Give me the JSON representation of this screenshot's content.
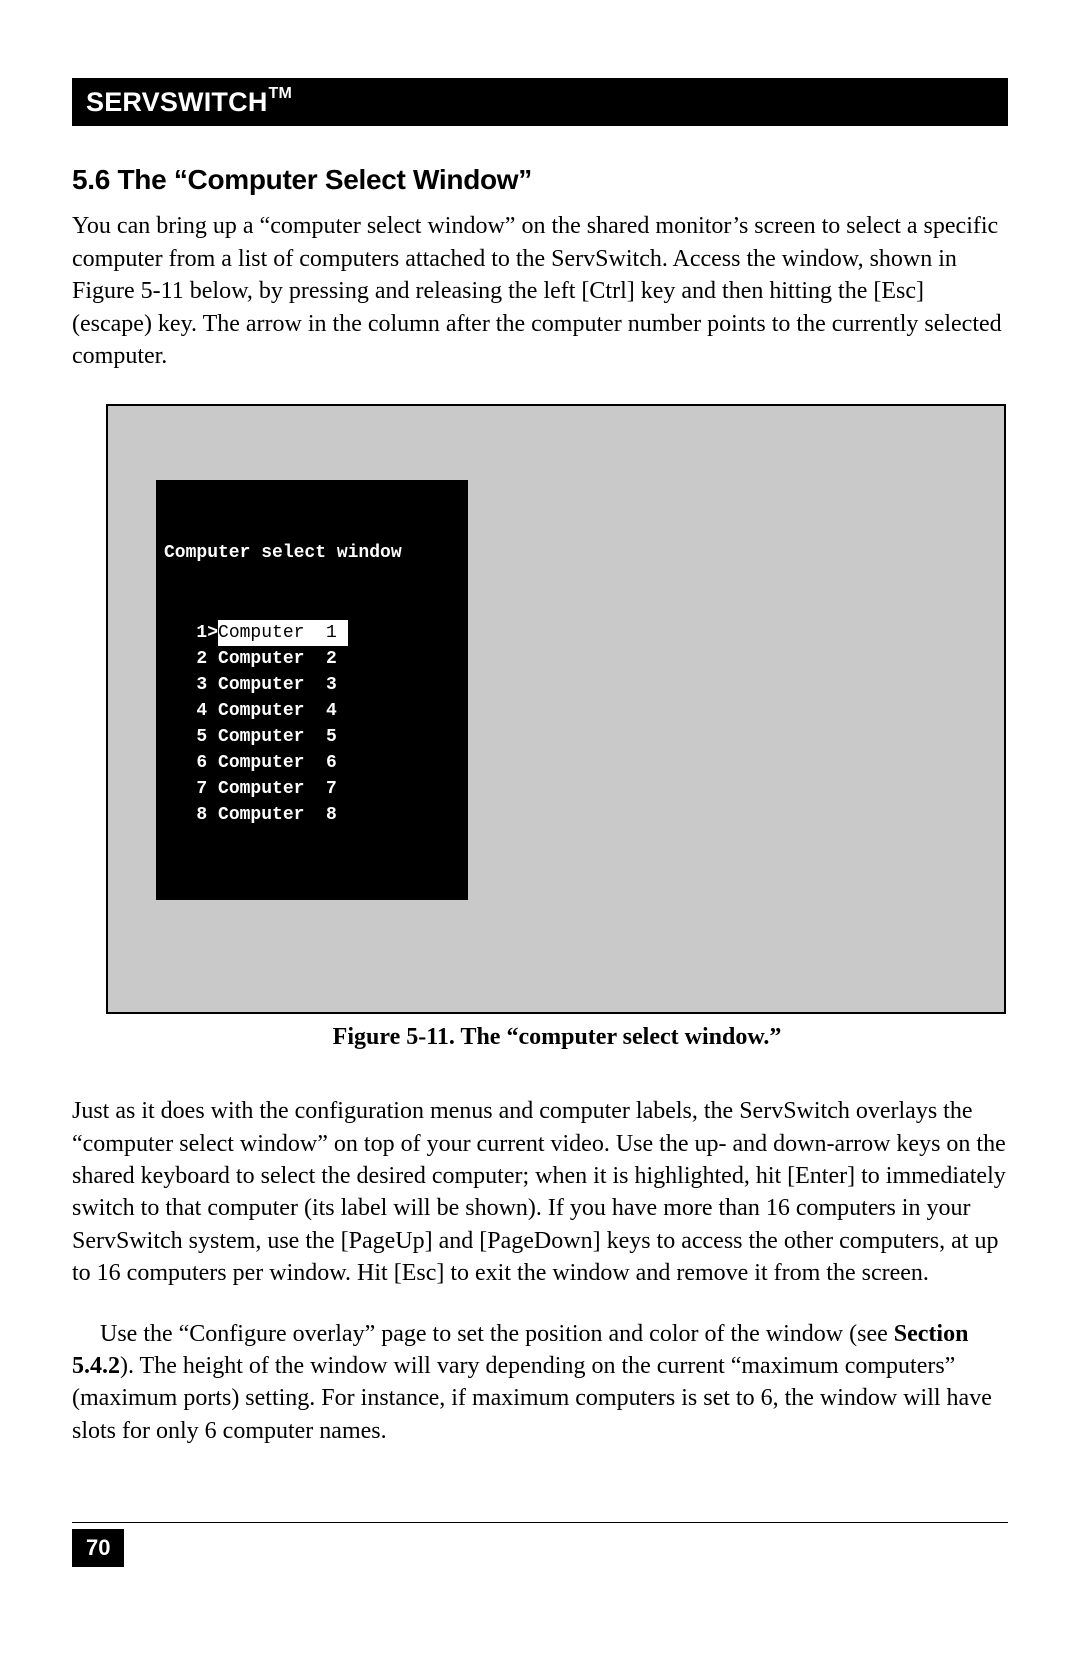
{
  "header": {
    "brand": "SERVSWITCH",
    "tm": "TM"
  },
  "section": {
    "heading": "5.6 The “Computer Select Window”"
  },
  "para1": "You can bring up a “computer select window” on the shared monitor’s screen to select a specific computer from a list of computers attached to the ServSwitch. Access the window, shown in Figure 5-11 below, by pressing and releasing the left [Ctrl] key and then hitting the [Esc] (escape) key. The arrow in the column after the computer number points to the currently selected computer.",
  "figure": {
    "panel_title": "Computer select window",
    "selected_index": 1,
    "rows": [
      {
        "num": "1",
        "label": "Computer  1"
      },
      {
        "num": "2",
        "label": "Computer  2"
      },
      {
        "num": "3",
        "label": "Computer  3"
      },
      {
        "num": "4",
        "label": "Computer  4"
      },
      {
        "num": "5",
        "label": "Computer  5"
      },
      {
        "num": "6",
        "label": "Computer  6"
      },
      {
        "num": "7",
        "label": "Computer  7"
      },
      {
        "num": "8",
        "label": "Computer  8"
      }
    ],
    "caption": "Figure 5-11. The “computer select window.”"
  },
  "para2": "Just as it does with the configuration menus and computer labels, the ServSwitch overlays the “computer select window” on top of your current video. Use the up- and down-arrow keys on the shared keyboard to select the desired computer; when it is highlighted, hit [Enter] to immediately switch to that computer (its label will be shown). If you have more than 16 computers in your ServSwitch system, use the [PageUp] and [PageDown] keys to access the other computers, at up to 16 computers per window. Hit [Esc] to exit the window and remove it from the screen.",
  "para3_pre": "Use the “Configure overlay” page to set the position and color of the window (see ",
  "para3_bold": "Section 5.4.2",
  "para3_post": "). The height of the window will vary depending on the current “maximum computers” (maximum ports) setting. For instance, if maximum computers is set to 6, the window will have slots for only 6 computer names.",
  "page_number": "70"
}
